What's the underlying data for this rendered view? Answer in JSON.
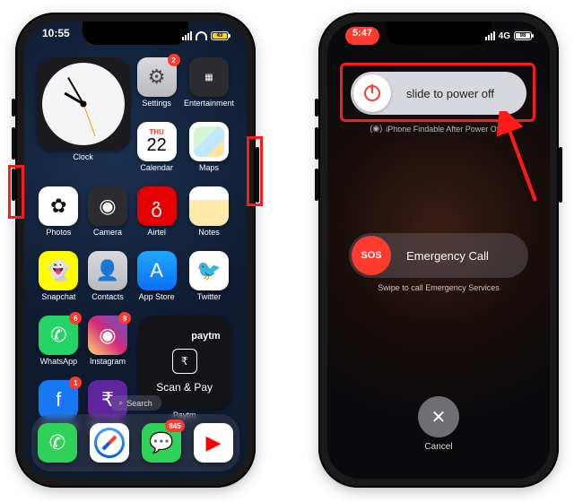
{
  "left": {
    "status": {
      "time": "10:55",
      "battery": "43"
    },
    "widgets": {
      "clock_label": "Clock",
      "paytm_brand": "paytm",
      "paytm_label": "Scan & Pay"
    },
    "apps": {
      "settings": {
        "label": "Settings",
        "badge": "2"
      },
      "entertain": {
        "label": "Entertainment"
      },
      "calendar": {
        "label": "Calendar",
        "weekday": "THU",
        "day": "22"
      },
      "maps": {
        "label": "Maps"
      },
      "photos": {
        "label": "Photos"
      },
      "camera": {
        "label": "Camera"
      },
      "airtel": {
        "label": "Airtel"
      },
      "notes": {
        "label": "Notes"
      },
      "snapchat": {
        "label": "Snapchat"
      },
      "contacts": {
        "label": "Contacts"
      },
      "appstore": {
        "label": "App Store"
      },
      "twitter": {
        "label": "Twitter"
      },
      "whatsapp": {
        "label": "WhatsApp",
        "badge": "6"
      },
      "instagram": {
        "label": "Instagram",
        "badge": "9"
      },
      "facebook": {
        "label": "Facebook",
        "badge": "1"
      },
      "phonepe": {
        "label": "PhonePe"
      },
      "paytm": {
        "label": "Paytm"
      }
    },
    "search": "Search",
    "dock": {
      "messages_badge": "845"
    }
  },
  "right": {
    "status": {
      "time": "5:47",
      "net": "4G",
      "battery": "98"
    },
    "slide_label": "slide to power off",
    "findable": "iPhone Findable After Power Off",
    "sos_knob": "SOS",
    "sos_label": "Emergency Call",
    "sos_sub": "Swipe to call Emergency Services",
    "cancel": "Cancel"
  }
}
